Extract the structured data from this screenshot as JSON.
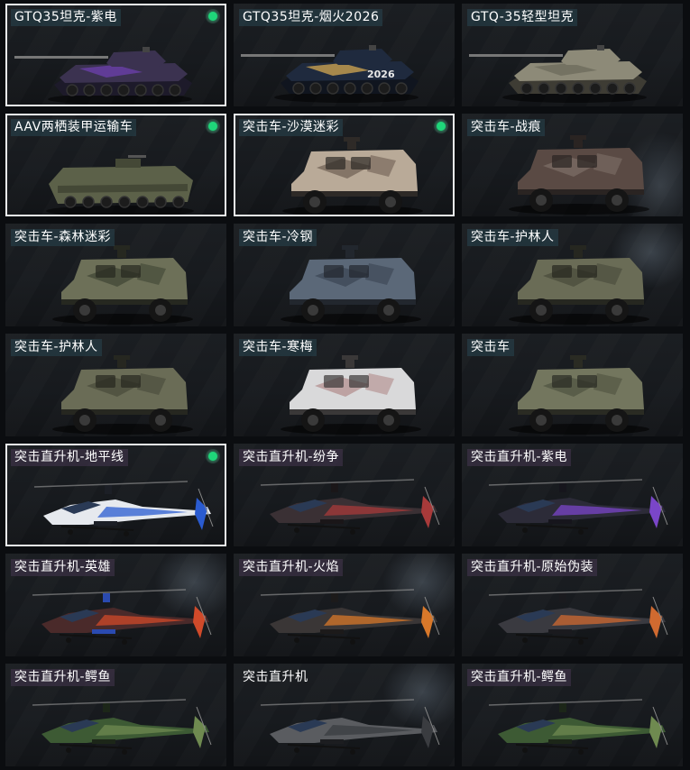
{
  "cards": [
    {
      "label": "GTQ35坦克-紫电",
      "kind": "tank",
      "selected": true,
      "owned": true,
      "colors": [
        "#3b3250",
        "#6a3fa8",
        "#1d1a2a"
      ]
    },
    {
      "label": "GTQ35坦克-烟火2026",
      "kind": "tank",
      "selected": false,
      "owned": false,
      "colors": [
        "#1f2a3e",
        "#c8a050",
        "#10151f"
      ],
      "decal": "2026"
    },
    {
      "label": "GTQ-35轻型坦克",
      "kind": "tank",
      "selected": false,
      "owned": false,
      "colors": [
        "#8d8a78",
        "#6e6b5c",
        "#3e3c34"
      ]
    },
    {
      "label": "AAV两栖装甲运输车",
      "kind": "aav",
      "selected": true,
      "owned": true,
      "colors": [
        "#5c6149",
        "#444836",
        "#2a2c22"
      ]
    },
    {
      "label": "突击车-沙漠迷彩",
      "kind": "truck",
      "selected": true,
      "owned": true,
      "colors": [
        "#b9aa98",
        "#6e5e52",
        "#2e2a27"
      ]
    },
    {
      "label": "突击车-战痕",
      "kind": "truck",
      "selected": false,
      "owned": false,
      "colors": [
        "#5a4a44",
        "#7d6f68",
        "#2a2422"
      ]
    },
    {
      "label": "突击车-森林迷彩",
      "kind": "truck",
      "selected": false,
      "owned": false,
      "colors": [
        "#6d7058",
        "#3f4433",
        "#262820"
      ]
    },
    {
      "label": "突击车-冷钢",
      "kind": "truck",
      "selected": false,
      "owned": false,
      "colors": [
        "#5b6878",
        "#3a4452",
        "#22272e"
      ]
    },
    {
      "label": "突击车-护林人",
      "kind": "truck",
      "selected": false,
      "owned": false,
      "colors": [
        "#6a6c56",
        "#484a3a",
        "#262720"
      ]
    },
    {
      "label": "突击车-护林人",
      "kind": "truck",
      "selected": false,
      "owned": false,
      "colors": [
        "#6a6c56",
        "#484a3a",
        "#262720"
      ]
    },
    {
      "label": "突击车-寒梅",
      "kind": "truck",
      "selected": false,
      "owned": false,
      "colors": [
        "#d9d9da",
        "#b08a8a",
        "#3a3838"
      ]
    },
    {
      "label": "突击车",
      "kind": "truck",
      "selected": false,
      "owned": false,
      "colors": [
        "#73765e",
        "#4f5240",
        "#2a2b23"
      ]
    },
    {
      "label": "突击直升机-地平线",
      "kind": "heli",
      "selected": true,
      "owned": true,
      "colors": [
        "#e6e9ee",
        "#2a5bd0",
        "#1c1f26"
      ]
    },
    {
      "label": "突击直升机-纷争",
      "kind": "heli",
      "selected": false,
      "owned": false,
      "colors": [
        "#3a3034",
        "#a83a3a",
        "#1a1618"
      ]
    },
    {
      "label": "突击直升机-紫电",
      "kind": "heli",
      "selected": false,
      "owned": false,
      "colors": [
        "#2c2b38",
        "#7a46c8",
        "#16151c"
      ]
    },
    {
      "label": "突击直升机-英雄",
      "kind": "heli",
      "selected": false,
      "owned": false,
      "colors": [
        "#4a2a2a",
        "#d04a2a",
        "#2a4ab0"
      ]
    },
    {
      "label": "突击直升机-火焰",
      "kind": "heli",
      "selected": false,
      "owned": false,
      "colors": [
        "#3a3636",
        "#d8782a",
        "#1c1a1a"
      ]
    },
    {
      "label": "突击直升机-原始伪装",
      "kind": "heli",
      "selected": false,
      "owned": false,
      "colors": [
        "#3a3a40",
        "#d06a30",
        "#1a1a1e"
      ]
    },
    {
      "label": "突击直升机-鳄鱼",
      "kind": "heli",
      "selected": false,
      "owned": false,
      "colors": [
        "#3d5a34",
        "#6f8a50",
        "#1c2618"
      ]
    },
    {
      "label": "突击直升机",
      "kind": "heli",
      "selected": false,
      "owned": false,
      "colors": [
        "#5a5c60",
        "#3a3c40",
        "#1c1d20"
      ],
      "plain": true
    },
    {
      "label": "突击直升机-鳄鱼",
      "kind": "heli",
      "selected": false,
      "owned": false,
      "colors": [
        "#3d5a34",
        "#6f8a50",
        "#1c2618"
      ]
    }
  ],
  "badge_color": "#1fd67a",
  "selected_border": "#eceff1"
}
